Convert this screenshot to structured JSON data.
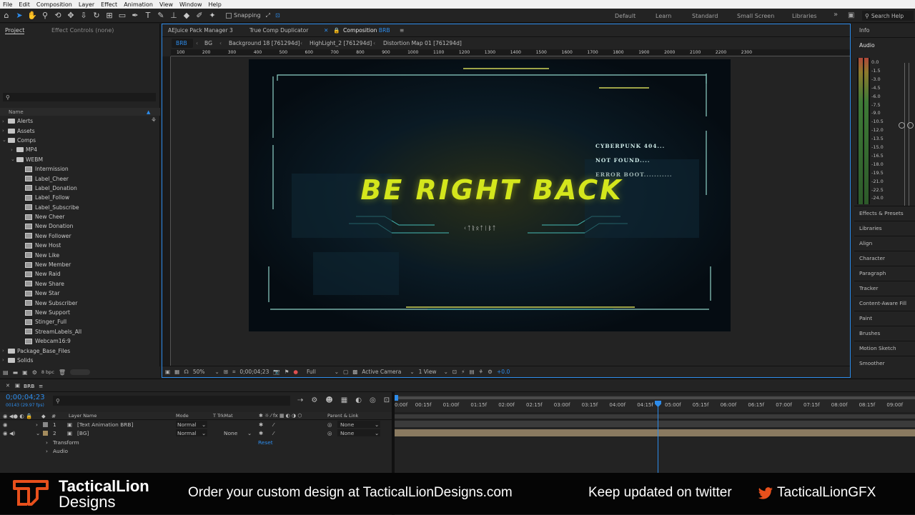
{
  "menu": [
    "File",
    "Edit",
    "Composition",
    "Layer",
    "Effect",
    "Animation",
    "View",
    "Window",
    "Help"
  ],
  "toolbar": {
    "snapping_label": "Snapping",
    "workspaces": [
      "Default",
      "Learn",
      "Standard",
      "Small Screen",
      "Libraries"
    ],
    "more": "»",
    "search_placeholder": "Search Help"
  },
  "project": {
    "tab_project": "Project",
    "tab_effect_controls": "Effect Controls (none)",
    "search_placeholder": "",
    "column_name": "Name",
    "bpc": "8 bpc",
    "tree": [
      {
        "label": "Alerts",
        "type": "folder",
        "depth": 0,
        "open": false
      },
      {
        "label": "Assets",
        "type": "folder",
        "depth": 0,
        "open": false
      },
      {
        "label": "Comps",
        "type": "folder",
        "depth": 0,
        "open": true
      },
      {
        "label": "MP4",
        "type": "folder",
        "depth": 1,
        "open": false
      },
      {
        "label": "WEBM",
        "type": "folder",
        "depth": 1,
        "open": true
      },
      {
        "label": "Intermission",
        "type": "comp",
        "depth": 2
      },
      {
        "label": "Label_Cheer",
        "type": "comp",
        "depth": 2
      },
      {
        "label": "Label_Donation",
        "type": "comp",
        "depth": 2
      },
      {
        "label": "Label_Follow",
        "type": "comp",
        "depth": 2
      },
      {
        "label": "Label_Subscribe",
        "type": "comp",
        "depth": 2
      },
      {
        "label": "New Cheer",
        "type": "comp",
        "depth": 2
      },
      {
        "label": "New Donation",
        "type": "comp",
        "depth": 2
      },
      {
        "label": "New Follower",
        "type": "comp",
        "depth": 2
      },
      {
        "label": "New Host",
        "type": "comp",
        "depth": 2
      },
      {
        "label": "New Like",
        "type": "comp",
        "depth": 2
      },
      {
        "label": "New Member",
        "type": "comp",
        "depth": 2
      },
      {
        "label": "New Raid",
        "type": "comp",
        "depth": 2
      },
      {
        "label": "New Share",
        "type": "comp",
        "depth": 2
      },
      {
        "label": "New Star",
        "type": "comp",
        "depth": 2
      },
      {
        "label": "New Subscriber",
        "type": "comp",
        "depth": 2
      },
      {
        "label": "New Support",
        "type": "comp",
        "depth": 2
      },
      {
        "label": "Stinger_Full",
        "type": "comp",
        "depth": 2
      },
      {
        "label": "StreamLabels_All",
        "type": "comp",
        "depth": 2
      },
      {
        "label": "Webcam16:9",
        "type": "comp",
        "depth": 2
      },
      {
        "label": "Package_Base_Files",
        "type": "folder",
        "depth": 0,
        "open": false
      },
      {
        "label": "Solids",
        "type": "folder",
        "depth": 0,
        "open": false
      }
    ]
  },
  "comp_panel": {
    "tabs": [
      "AEJuice Pack Manager 3",
      "True Comp Duplicator",
      "Composition"
    ],
    "active_comp": "BRB",
    "breadcrumbs": [
      "BRB",
      "BG",
      "Background 18 [761294d]",
      "HighLight_2 [761294d]",
      "Distortion Map 01 [761294d]"
    ],
    "ruler_labels": [
      "100",
      "200",
      "300",
      "400",
      "500",
      "600",
      "700",
      "800",
      "900",
      "1000",
      "1100",
      "1200",
      "1300",
      "1400",
      "1500",
      "1600",
      "1700",
      "1800",
      "1900",
      "2000",
      "2100",
      "2200",
      "2300"
    ],
    "preview": {
      "title": "BE RIGHT BACK",
      "side_lines": [
        "CYBERPUNK 404...",
        "NOT FOUND....",
        "ERROR BOOT..........."
      ],
      "glyphs": "ᚲᛏᚱᛟᛏᛁᛒᛏ"
    },
    "footer": {
      "zoom": "50%",
      "timecode": "0;00;04;23",
      "resolution": "Full",
      "camera": "Active Camera",
      "views": "1 View",
      "exposure": "+0.0"
    }
  },
  "right_panel": {
    "info": "Info",
    "audio": "Audio",
    "db_labels": [
      "0.0",
      "-1.5",
      "-3.0",
      "-4.5",
      "-6.0",
      "-7.5",
      "-9.0",
      "-10.5",
      "-12.0",
      "-13.5",
      "-15.0",
      "-16.5",
      "-18.0",
      "-19.5",
      "-21.0",
      "-22.5",
      "-24.0"
    ],
    "panels": [
      "Effects & Presets",
      "Libraries",
      "Align",
      "Character",
      "Paragraph",
      "Tracker",
      "Content-Aware Fill",
      "Paint",
      "Brushes",
      "Motion Sketch",
      "Smoother"
    ]
  },
  "timeline": {
    "comp_tab": "BRB",
    "timecode": "0;00;04;23",
    "frame_info": "00143 (29.97 fps)",
    "headers": {
      "layer_name": "Layer Name",
      "mode": "Mode",
      "trkmat": "T TrkMat",
      "parent": "Parent & Link",
      "num": "#"
    },
    "layers": [
      {
        "num": "1",
        "name": "[Text Animation BRB]",
        "mode": "Normal",
        "trkmat": "",
        "parent": "None"
      },
      {
        "num": "2",
        "name": "[BG]",
        "mode": "Normal",
        "trkmat": "None",
        "parent": "None"
      }
    ],
    "props": [
      "Transform",
      "Audio"
    ],
    "reset": "Reset",
    "ruler": [
      "0:00f",
      "00:15f",
      "01:00f",
      "01:15f",
      "02:00f",
      "02:15f",
      "03:00f",
      "03:15f",
      "04:00f",
      "04:15f",
      "05:00f",
      "05:15f",
      "06:00f",
      "06:15f",
      "07:00f",
      "07:15f",
      "08:00f",
      "08:15f",
      "09:00f"
    ]
  },
  "banner": {
    "brand_line1": "TacticalLion",
    "brand_line2": "Designs",
    "order_text": "Order your custom design at TacticalLionDesigns.com",
    "twitter_text": "Keep updated on twitter",
    "twitter_handle": "TacticalLionGFX",
    "accent": "#e8501c",
    "twitter_color": "#e8501c"
  },
  "colors": {
    "accent_blue": "#2d8ceb",
    "title_yellow": "#d4e61c",
    "hud_cyan": "#4fd6d0",
    "layer_bar": "#8a7a60"
  }
}
